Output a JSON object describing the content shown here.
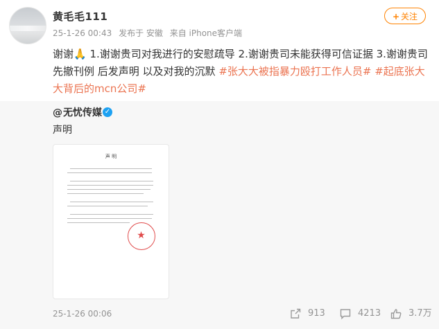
{
  "post": {
    "username": "黄毛毛111",
    "time": "25-1-26 00:43",
    "location": "发布于 安徽",
    "source": "来自 iPhone客户端",
    "follow_label": "关注",
    "follow_plus": "+",
    "text_plain_1": "谢谢🙏 1.谢谢贵司对我进行的安慰疏导 2.谢谢贵司未能获得可信证据 3.谢谢贵司先撤刊例 后发声明 以及对我的沉默 ",
    "hashtag_1": "#张大大被指暴力殴打工作人员#",
    "text_plain_2": " ",
    "hashtag_2": "#起底张大大背后的mcn公司#"
  },
  "retweet": {
    "at": "@",
    "author": "无忧传媒",
    "text": "声明",
    "doc_title": "声 明",
    "date": "25-1-26 00:06",
    "verified_mark": "✓",
    "seal_star": "★",
    "stats": {
      "reposts": "913",
      "comments": "4213",
      "likes": "3.7万"
    }
  },
  "colors": {
    "accent": "#ff8200",
    "hashtag": "#eb7350",
    "meta_gray": "#939393",
    "retweet_bg": "#f7f7f7"
  },
  "icons": [
    "repost-icon",
    "comment-icon",
    "like-icon",
    "verified-icon",
    "follow-plus-icon"
  ]
}
